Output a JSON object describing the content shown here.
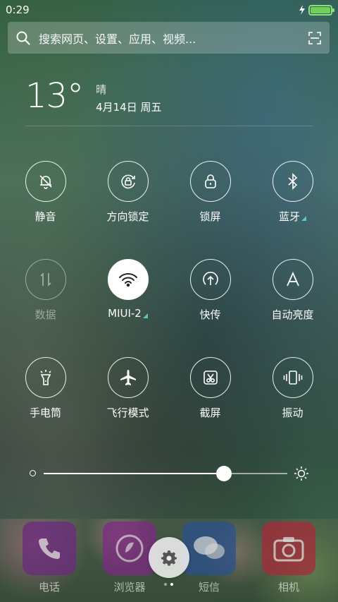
{
  "status_bar": {
    "time": "0:29",
    "charging_icon": "lightning-icon",
    "battery_color": "#6fd05a"
  },
  "search": {
    "placeholder": "搜索网页、设置、应用、视频...",
    "scan_icon": "scan-icon"
  },
  "weather": {
    "temperature": "13°",
    "condition": "晴",
    "date": "4月14日 周五"
  },
  "toggles": [
    {
      "label": "静音",
      "icon": "bell-off-icon",
      "state": "off"
    },
    {
      "label": "方向锁定",
      "icon": "rotation-lock-icon",
      "state": "off"
    },
    {
      "label": "锁屏",
      "icon": "lock-icon",
      "state": "off"
    },
    {
      "label": "蓝牙",
      "icon": "bluetooth-icon",
      "state": "off",
      "has_more": true
    },
    {
      "label": "数据",
      "icon": "mobile-data-icon",
      "state": "disabled"
    },
    {
      "label": "MIUI-2",
      "icon": "wifi-icon",
      "state": "on",
      "has_more": true
    },
    {
      "label": "快传",
      "icon": "quick-transfer-icon",
      "state": "off"
    },
    {
      "label": "自动亮度",
      "icon": "auto-brightness-icon",
      "state": "off"
    },
    {
      "label": "手电筒",
      "icon": "flashlight-icon",
      "state": "off"
    },
    {
      "label": "飞行模式",
      "icon": "airplane-icon",
      "state": "off"
    },
    {
      "label": "截屏",
      "icon": "screenshot-icon",
      "state": "off"
    },
    {
      "label": "振动",
      "icon": "vibrate-icon",
      "state": "off"
    }
  ],
  "brightness": {
    "level_fraction": 0.74
  },
  "dock": {
    "apps": [
      {
        "label": "电话",
        "icon": "phone-icon",
        "color": "#7a2a8a"
      },
      {
        "label": "浏览器",
        "icon": "browser-icon",
        "color": "#8a2a8a"
      },
      {
        "label": "短信",
        "icon": "message-icon",
        "color": "#2a5a9a"
      },
      {
        "label": "相机",
        "icon": "camera-icon",
        "color": "#b02a3a"
      }
    ],
    "settings_icon": "gear-icon",
    "page_count": 2,
    "active_page": 1
  }
}
